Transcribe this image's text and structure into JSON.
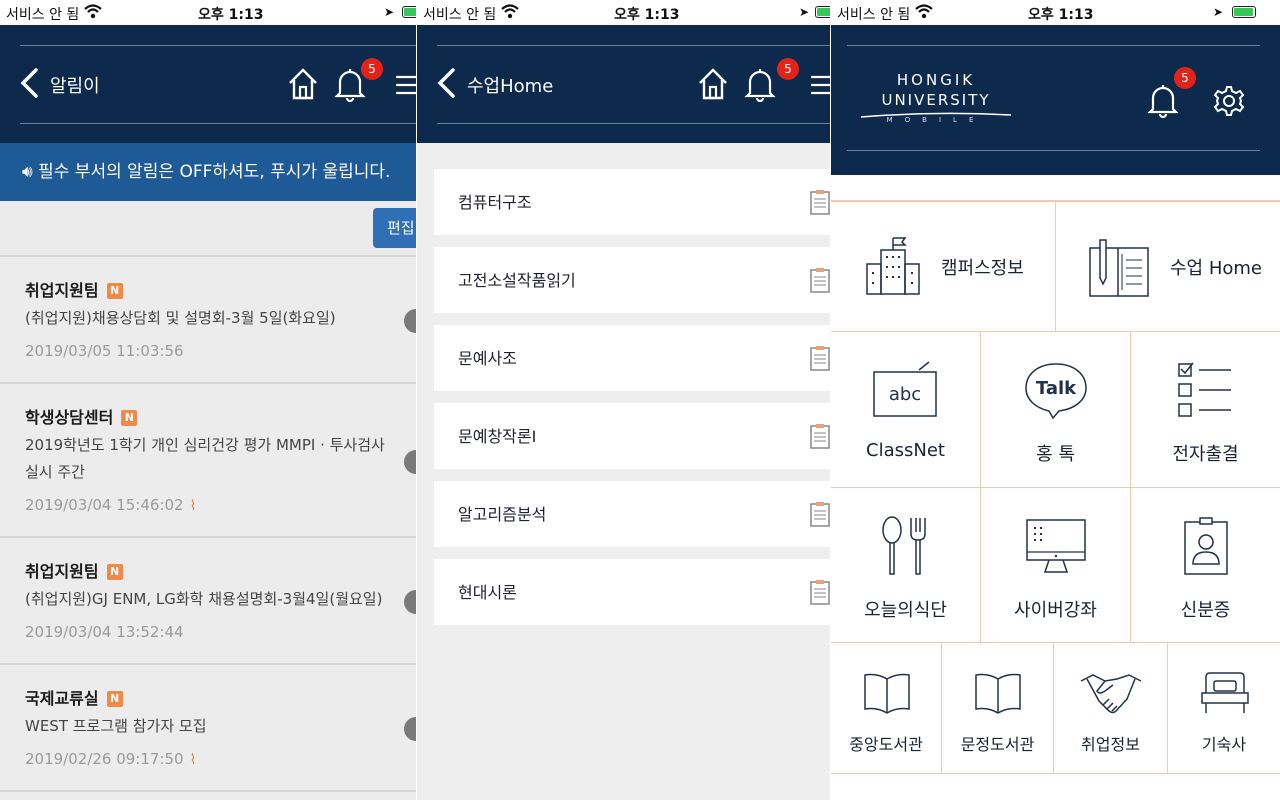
{
  "status_bar": {
    "carrier": "서비스 안 됨",
    "time": "오후 1:13"
  },
  "screen_notices": {
    "title": "알림이",
    "badge_count": "5",
    "banner": "필수 부서의 알림은 OFF하셔도, 푸시가 울립니다.",
    "edit_label": "편집",
    "new_badge": "N",
    "items": [
      {
        "dept": "취업지원팀",
        "message": "(취업지원)채용상담회 및 설명회-3월 5일(화요일)",
        "date": "2019/03/05 11:03:56",
        "attachment": false
      },
      {
        "dept": "학생상담센터",
        "message": "2019학년도 1학기 개인 심리건강 평가 MMPI · 투사검사 실시 주간",
        "date": "2019/03/04 15:46:02",
        "attachment": true
      },
      {
        "dept": "취업지원팀",
        "message": "(취업지원)GJ ENM, LG화학 채용설명회-3월4일(월요일)",
        "date": "2019/03/04 13:52:44",
        "attachment": false
      },
      {
        "dept": "국제교류실",
        "message": "WEST 프로그램 참가자 모집",
        "date": "2019/02/26 09:17:50",
        "attachment": true
      }
    ]
  },
  "screen_class": {
    "title": "수업Home",
    "badge_count": "5",
    "courses": [
      "컴퓨터구조",
      "고전소설작품읽기",
      "문예사조",
      "문예창작론I",
      "알고리즘분석",
      "현대시론"
    ]
  },
  "screen_home": {
    "logo_line1": "HONGIK",
    "logo_line2": "UNIVERSITY",
    "logo_line3": "MOBILE",
    "badge_count": "5",
    "menu": {
      "campus": "캠퍼스정보",
      "class_home": "수업 Home",
      "classnet": "ClassNet",
      "talk": "홍 톡",
      "talk_icon_text": "Talk",
      "abc_icon_text": "abc",
      "attendance": "전자출결",
      "cafeteria": "오늘의식단",
      "cyber": "사이버강좌",
      "id_card": "신분증",
      "central_library": "중앙도서관",
      "munjeong_library": "문정도서관",
      "jobs": "취업정보",
      "dorm": "기숙사"
    }
  },
  "colors": {
    "navy": "#0d2a4d",
    "banner_blue": "#1e5a95",
    "badge_red": "#e2231a",
    "new_orange": "#f08a4b",
    "grid_line": "#f3c9b4"
  }
}
